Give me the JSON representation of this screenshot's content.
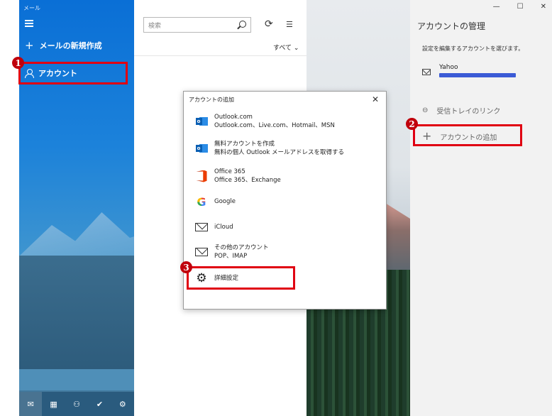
{
  "nav": {
    "app_title": "メール",
    "new_mail": "メールの新規作成",
    "account": "アカウント",
    "bottom_icons": [
      "mail-icon",
      "calendar-icon",
      "people-icon",
      "todo-icon",
      "settings-icon"
    ]
  },
  "list": {
    "search_placeholder": "検索",
    "filter": "すべて"
  },
  "manage": {
    "title": "アカウントの管理",
    "subtitle": "設定を編集するアカウントを選びます。",
    "account_name": "Yahoo",
    "link_inbox": "受信トレイのリンク",
    "add_account": "アカウントの追加"
  },
  "dialog": {
    "title": "アカウントの追加",
    "options": [
      {
        "name": "Outlook.com",
        "desc": "Outlook.com、Live.com、Hotmail、MSN",
        "icon": "outlook-icon"
      },
      {
        "name": "無料アカウントを作成",
        "desc": "無料の個人 Outlook メールアドレスを取得する",
        "icon": "outlook-icon"
      },
      {
        "name": "Office 365",
        "desc": "Office 365、Exchange",
        "icon": "office-icon"
      },
      {
        "name": "Google",
        "desc": "",
        "icon": "google-icon"
      },
      {
        "name": "iCloud",
        "desc": "",
        "icon": "mail-icon"
      },
      {
        "name": "その他のアカウント",
        "desc": "POP、IMAP",
        "icon": "mail-icon"
      },
      {
        "name": "詳細設定",
        "desc": "",
        "icon": "gear-icon"
      }
    ]
  },
  "annotations": {
    "badge1": "1",
    "badge2": "2",
    "badge3": "3",
    "highlight_color": "#e00012"
  }
}
